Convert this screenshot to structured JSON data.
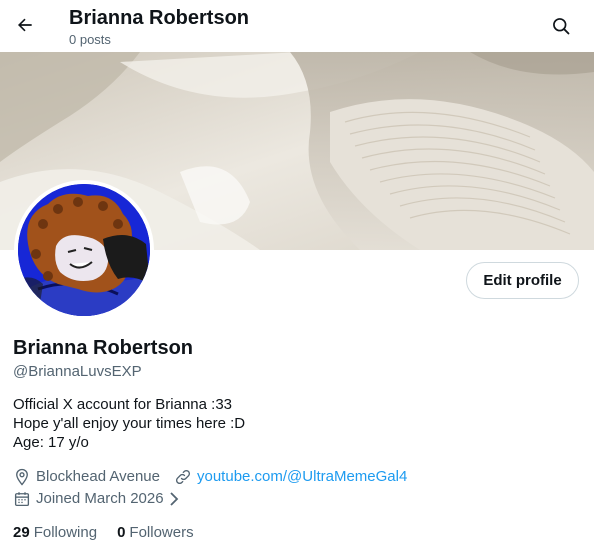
{
  "header": {
    "title": "Brianna Robertson",
    "post_count": "0 posts",
    "back_icon": "arrow-left-icon",
    "search_icon": "search-icon"
  },
  "profile": {
    "name": "Brianna Robertson",
    "handle": "@BriannaLuvsEXP",
    "edit_label": "Edit profile",
    "bio": [
      "Official X account for Brianna :33",
      "Hope y'all enjoy your times here :D",
      "Age: 17 y/o"
    ],
    "location": "Blockhead Avenue",
    "website": "youtube.com/@UltraMemeGal4",
    "joined": "Joined March 2026",
    "following_count": "29",
    "following_label": "Following",
    "followers_count": "0",
    "followers_label": "Followers"
  },
  "colors": {
    "text_primary": "#0f1419",
    "text_secondary": "#536471",
    "link": "#1d9bf0",
    "border": "#cfd9de",
    "avatar_bg": "#1727d6",
    "hair": "#a1521b"
  }
}
